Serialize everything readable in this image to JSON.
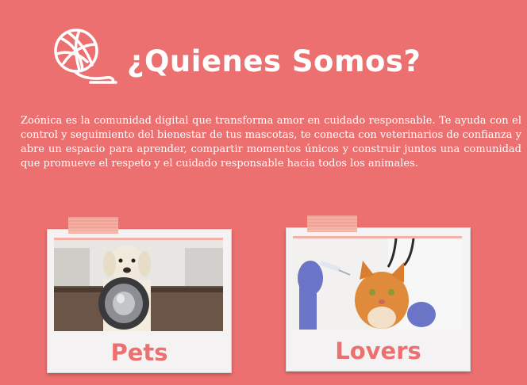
{
  "header": {
    "title": "¿Quienes Somos?",
    "icon": "yarn-ball-icon"
  },
  "intro": {
    "text": "Zoónica es la comunidad digital que transforma amor en cuidado responsable. Te ayuda con el control y seguimiento del bienestar de tus mascotas, te conecta con veterinarios de confianza y abre un espacio para aprender, compartir momentos únicos y construir juntos una comunidad que promueve el respeto y el cuidado responsable hacia todos los animales."
  },
  "cards": [
    {
      "label": "Pets",
      "image": "dog-with-bowl-photo"
    },
    {
      "label": "Lovers",
      "image": "vet-with-cat-photo"
    }
  ],
  "colors": {
    "background": "#ec7070",
    "accent": "#ec7070",
    "text": "#ffffff",
    "card": "#f4f2f2"
  }
}
